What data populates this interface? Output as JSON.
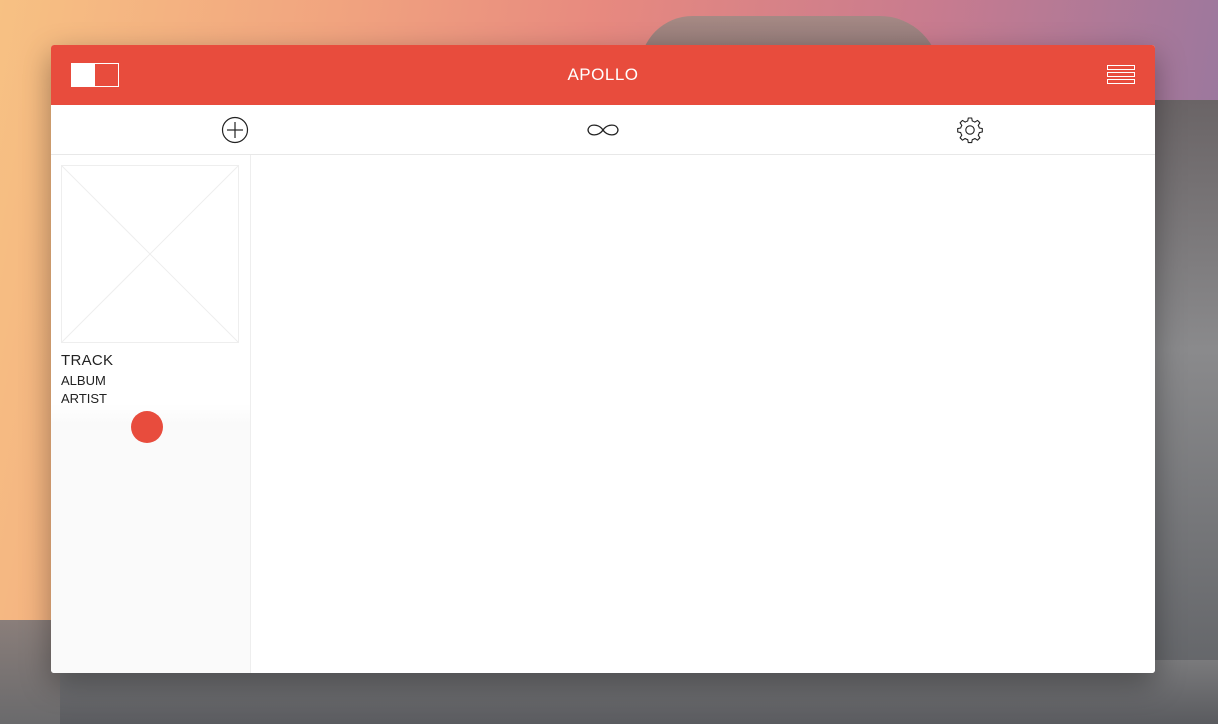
{
  "app": {
    "title": "APOLLO",
    "accent_color": "#e84c3d"
  },
  "titlebar": {
    "layout_toggle_icon": "split-view-icon",
    "menu_icon": "hamburger-menu-icon"
  },
  "toolbar": {
    "items": [
      {
        "icon": "plus-circle-icon"
      },
      {
        "icon": "infinity-loop-icon"
      },
      {
        "icon": "gear-icon"
      }
    ]
  },
  "now_playing": {
    "artwork_icon": "image-placeholder-icon",
    "track": "TRACK",
    "album": "ALBUM",
    "artist": "ARTIST",
    "play_button_color": "#e84c3d"
  }
}
